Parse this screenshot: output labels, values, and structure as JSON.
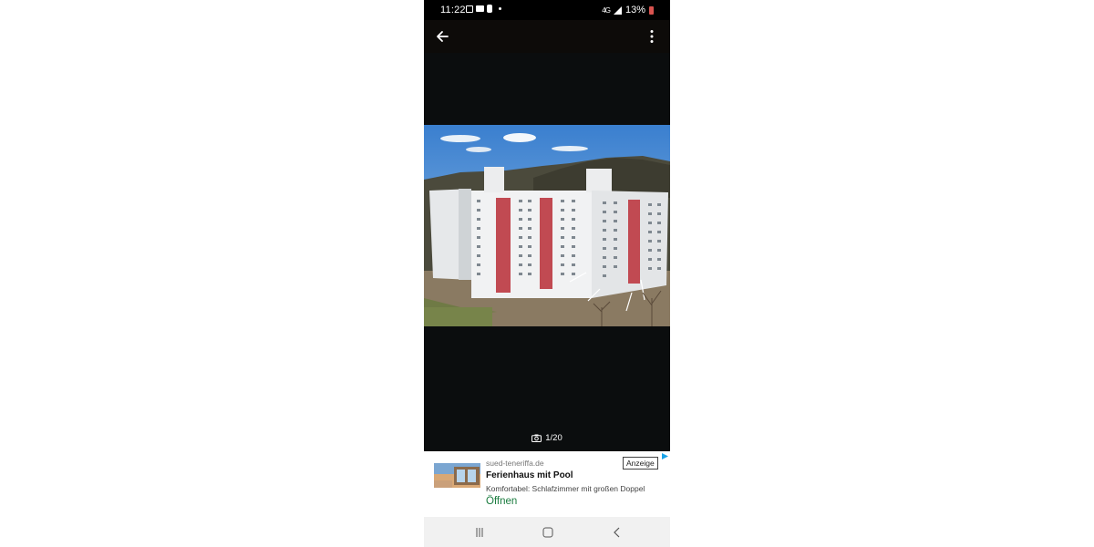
{
  "status_bar": {
    "time": "11:22",
    "network": "4G",
    "battery": "13%",
    "notification_icons": [
      "screen-record-icon",
      "mail-icon",
      "clipboard-icon",
      "dot-icon"
    ]
  },
  "app_bar": {
    "back_icon": "arrow-left-icon",
    "more_icon": "more-vertical-icon"
  },
  "gallery": {
    "counter": "1/20",
    "camera_icon": "camera-icon"
  },
  "ad": {
    "domain": "sued-teneriffa.de",
    "title": "Ferienhaus mit Pool",
    "description": "Komfortabel: Schlafzimmer mit großen Doppel",
    "cta": "Öffnen",
    "badge": "Anzeige"
  },
  "nav_bar": {
    "icons": [
      "recent-apps-icon",
      "home-icon",
      "back-icon"
    ]
  },
  "colors": {
    "background": "#0b0d0e",
    "cta_green": "#1a7c3f",
    "battery_low": "#d9534f",
    "balcony_red": "#c14a52"
  }
}
